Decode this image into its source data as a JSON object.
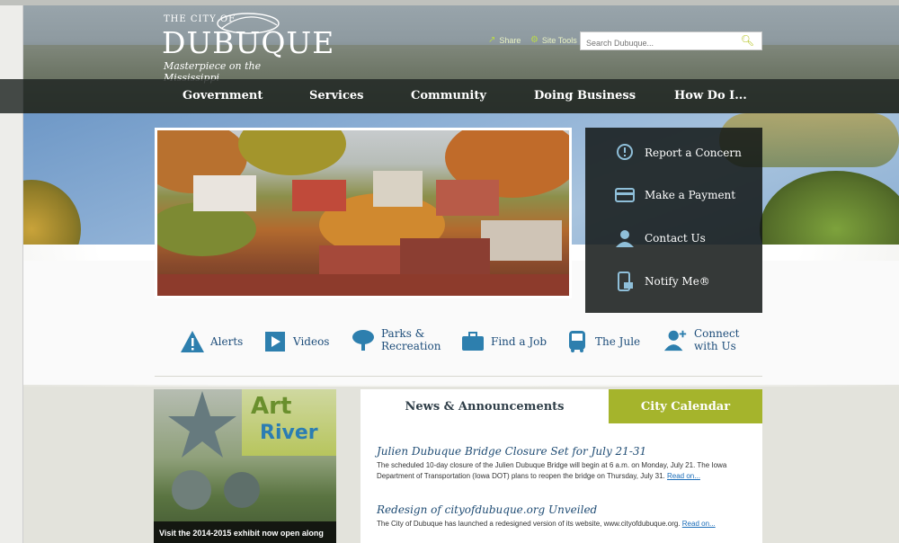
{
  "header": {
    "logo_the": "THE CITY OF",
    "logo_city": "DUBUQUE",
    "logo_tagline": "Masterpiece on the Mississippi",
    "share_label": "Share",
    "site_tools_label": "Site Tools",
    "search_placeholder": "Search Dubuque..."
  },
  "nav": [
    "Government",
    "Services",
    "Community",
    "Doing Business",
    "How Do I..."
  ],
  "quick_links": [
    {
      "label": "Report a Concern",
      "icon": "alert-bubble-icon"
    },
    {
      "label": "Make a Payment",
      "icon": "payment-card-icon"
    },
    {
      "label": "Contact Us",
      "icon": "contact-icon"
    },
    {
      "label": "Notify Me®",
      "icon": "notify-phone-icon"
    }
  ],
  "icon_links": [
    {
      "label": "Alerts",
      "icon": "warning-icon"
    },
    {
      "label": "Videos",
      "icon": "play-icon"
    },
    {
      "label_1": "Parks &",
      "label_2": "Recreation",
      "icon": "tree-icon"
    },
    {
      "label": "Find a Job",
      "icon": "briefcase-icon"
    },
    {
      "label": "The Jule",
      "icon": "bus-icon"
    },
    {
      "label_1": "Connect",
      "label_2": "with Us",
      "icon": "add-user-icon"
    }
  ],
  "feature": {
    "logo_line1": "Art",
    "logo_line2": "River",
    "caption": "Visit the 2014-2015 exhibit now open along"
  },
  "news": {
    "tab_news": "News & Announcements",
    "tab_calendar": "City Calendar",
    "articles": [
      {
        "title": "Julien Dubuque Bridge Closure Set for July 21-31",
        "body": "The scheduled 10-day closure of the Julien Dubuque Bridge will begin at 6 a.m. on Monday, July 21. The Iowa Department of Transportation (Iowa DOT) plans to reopen the bridge on Thursday, July 31.",
        "more": "Read on..."
      },
      {
        "title": "Redesign of cityofdubuque.org Unveiled",
        "body": "The City of Dubuque has launched a redesigned version of its website, www.cityofdubuque.org.",
        "more": "Read on..."
      }
    ]
  },
  "colors": {
    "accent_green": "#a5b42c",
    "link_blue": "#1f4c74",
    "nav_bg": "#1e2422"
  }
}
